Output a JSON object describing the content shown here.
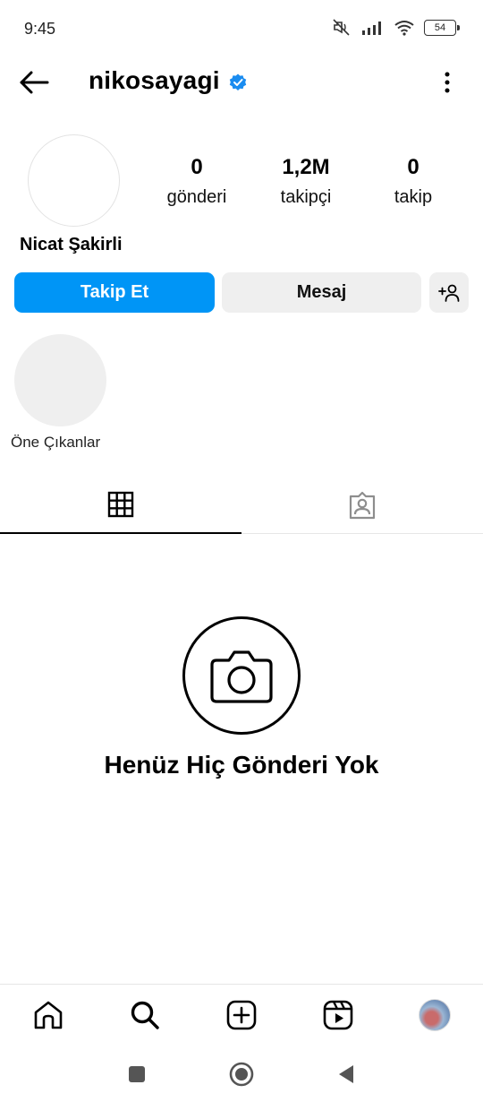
{
  "status_bar": {
    "time": "9:45",
    "battery": "54"
  },
  "header": {
    "username": "nikosayagi"
  },
  "profile": {
    "full_name": "Nicat Şakirli",
    "stats": [
      {
        "value": "0",
        "label": "gönderi"
      },
      {
        "value": "1,2M",
        "label": "takipçi"
      },
      {
        "value": "0",
        "label": "takip"
      }
    ]
  },
  "actions": {
    "follow_label": "Takip Et",
    "message_label": "Mesaj"
  },
  "highlights": {
    "label": "Öne Çıkanlar"
  },
  "empty_state": {
    "title": "Henüz Hiç Gönderi Yok"
  },
  "colors": {
    "accent": "#0095f6",
    "button_bg": "#efefef",
    "verified": "#1a8cf0"
  },
  "icons": {
    "header": [
      "back-arrow-icon",
      "verified-badge-icon",
      "more-vertical-icon"
    ],
    "tabs": [
      "grid-icon",
      "tagged-person-icon"
    ],
    "bottom_nav": [
      "home-icon",
      "search-icon",
      "create-plus-icon",
      "reels-icon",
      "profile-avatar"
    ],
    "system_nav": [
      "recents-square-icon",
      "home-circle-icon",
      "back-triangle-icon"
    ]
  }
}
